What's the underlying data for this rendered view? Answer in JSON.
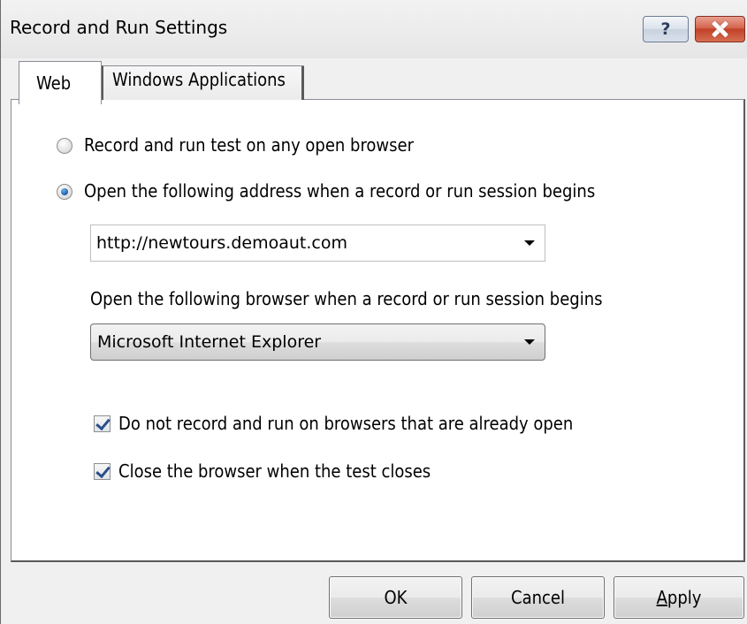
{
  "window": {
    "title": "Record and Run Settings",
    "help_label": "?"
  },
  "tabs": [
    {
      "label": "Web",
      "selected": true
    },
    {
      "label": "Windows Applications",
      "selected": false
    }
  ],
  "web": {
    "radio_any_browser": {
      "label": "Record and run test on any open browser",
      "checked": false
    },
    "radio_open_address": {
      "label": "Open the following address when a record or run session begins",
      "checked": true
    },
    "address_value": "http://newtours.demoaut.com",
    "browser_label": "Open the following browser when a record or run session begins",
    "browser_value": "Microsoft Internet Explorer",
    "checkbox_already_open": {
      "label": "Do not record and run on browsers that are already open",
      "checked": true
    },
    "checkbox_close_browser": {
      "label": "Close the browser when the test closes",
      "checked": true
    }
  },
  "buttons": {
    "ok": "OK",
    "cancel": "Cancel",
    "apply_underlined": "A",
    "apply_rest": "pply"
  }
}
